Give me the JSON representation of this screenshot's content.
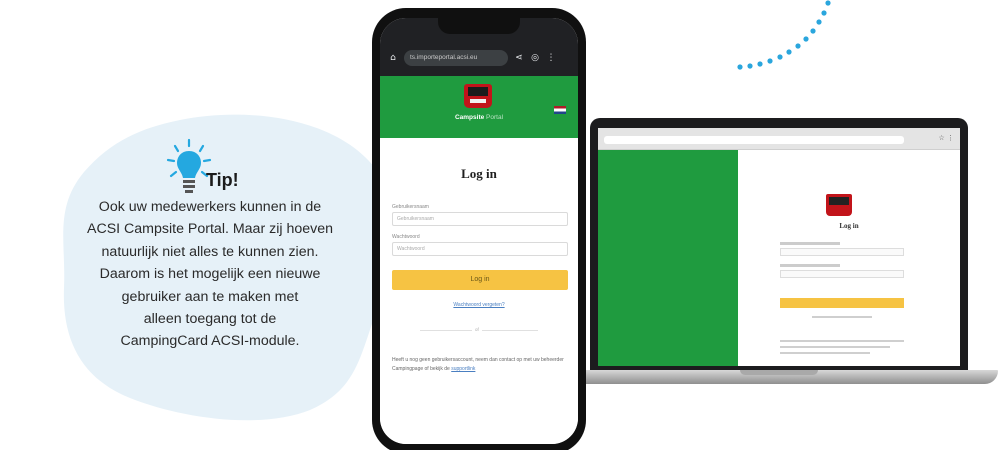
{
  "tip": {
    "title": "Tip!",
    "lines": [
      "Ook uw medewerkers kunnen in de",
      "ACSI Campsite Portal. Maar zij hoeven",
      "natuurlijk niet alles te kunnen zien.",
      "Daarom is het mogelijk een nieuwe",
      "gebruiker aan te maken met",
      "alleen toegang tot de",
      "CampingCard ACSI-module."
    ],
    "icon": "lightbulb-icon",
    "blob_color": "#e6f1f8",
    "bulb_color": "#24a8e0"
  },
  "phone": {
    "url": "ts.importeportal.acsi.eu",
    "brand_main": "Campsite",
    "brand_accent": "Portal",
    "login_title": "Log in",
    "username_label": "Gebruikersnaam",
    "username_placeholder": "Gebruikersnaam",
    "password_label": "Wachtwoord",
    "password_placeholder": "Wachtwoord",
    "login_button": "Log in",
    "forgot_link": "Wachtwoord vergeten?",
    "divider": "of",
    "info_text": "Heeft u nog geen gebruikersaccount, neem dan contact op met uw beheerder Campingpage of bekijk de ",
    "info_link": "supportlink",
    "header_color": "#1f9b3f",
    "button_color": "#f6c343"
  },
  "laptop": {
    "login_title": "Log in",
    "panel_color": "#1f9b3f"
  }
}
